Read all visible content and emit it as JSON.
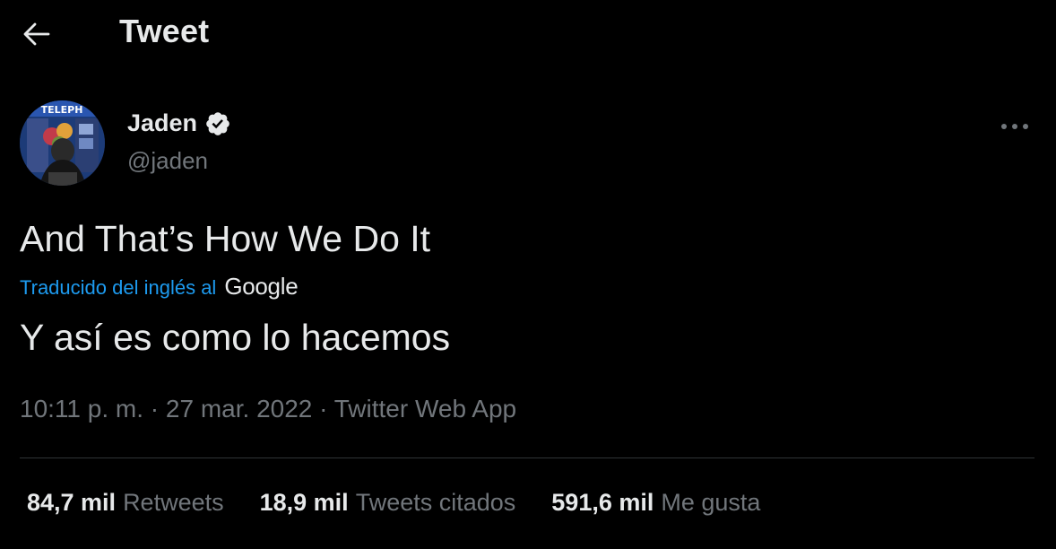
{
  "header": {
    "title": "Tweet",
    "back_icon": "arrow-left-icon"
  },
  "author": {
    "display_name": "Jaden",
    "handle": "@jaden",
    "verified": true,
    "verified_icon": "verified-badge-icon",
    "avatar_sign_text": "TELEPH"
  },
  "more_icon": "ellipsis-icon",
  "tweet": {
    "text": "And That’s How We Do It",
    "translation_label": "Traducido del inglés al",
    "translation_provider": "Google",
    "translated_text": "Y así es como lo hacemos"
  },
  "meta": {
    "time": "10:11 p. m.",
    "separator": " · ",
    "date": "27 mar. 2022",
    "source": "Twitter Web App"
  },
  "stats": [
    {
      "value": "84,7 mil",
      "label": "Retweets"
    },
    {
      "value": "18,9 mil",
      "label": "Tweets citados"
    },
    {
      "value": "591,6 mil",
      "label": "Me gusta"
    }
  ],
  "colors": {
    "background": "#000000",
    "primary_text": "#e7e9ea",
    "secondary_text": "#71767b",
    "link": "#1d9bf0",
    "divider": "#2f3336"
  }
}
